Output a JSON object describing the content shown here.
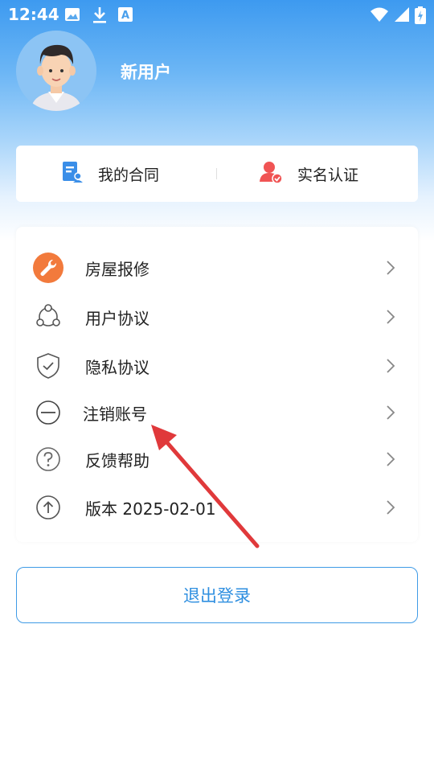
{
  "status_bar": {
    "time": "12:44",
    "left_icons": [
      "image-icon",
      "download-icon",
      "text-a-icon"
    ],
    "right_icons": [
      "wifi-icon",
      "signal-icon",
      "battery-icon"
    ]
  },
  "profile": {
    "username": "新用户",
    "avatar": "avatar"
  },
  "top_card": {
    "items": [
      {
        "label": "我的合同",
        "icon": "contract-icon",
        "color": "#3a8ee8"
      },
      {
        "label": "实名认证",
        "icon": "verify-user-icon",
        "color": "#f05454"
      }
    ]
  },
  "menu": {
    "items": [
      {
        "label": "房屋报修",
        "icon": "wrench-icon"
      },
      {
        "label": "用户协议",
        "icon": "share-icon"
      },
      {
        "label": "隐私协议",
        "icon": "shield-check-icon"
      },
      {
        "label": "注销账号",
        "icon": "minus-circle-icon"
      },
      {
        "label": "反馈帮助",
        "icon": "help-circle-icon"
      },
      {
        "label": "版本  2025-02-01",
        "icon": "upload-circle-icon"
      }
    ]
  },
  "logout": {
    "label": "退出登录"
  },
  "colors": {
    "accent": "#2f8fe0",
    "repair_icon": "#f27a3c",
    "annotation_arrow": "#e0393b"
  }
}
